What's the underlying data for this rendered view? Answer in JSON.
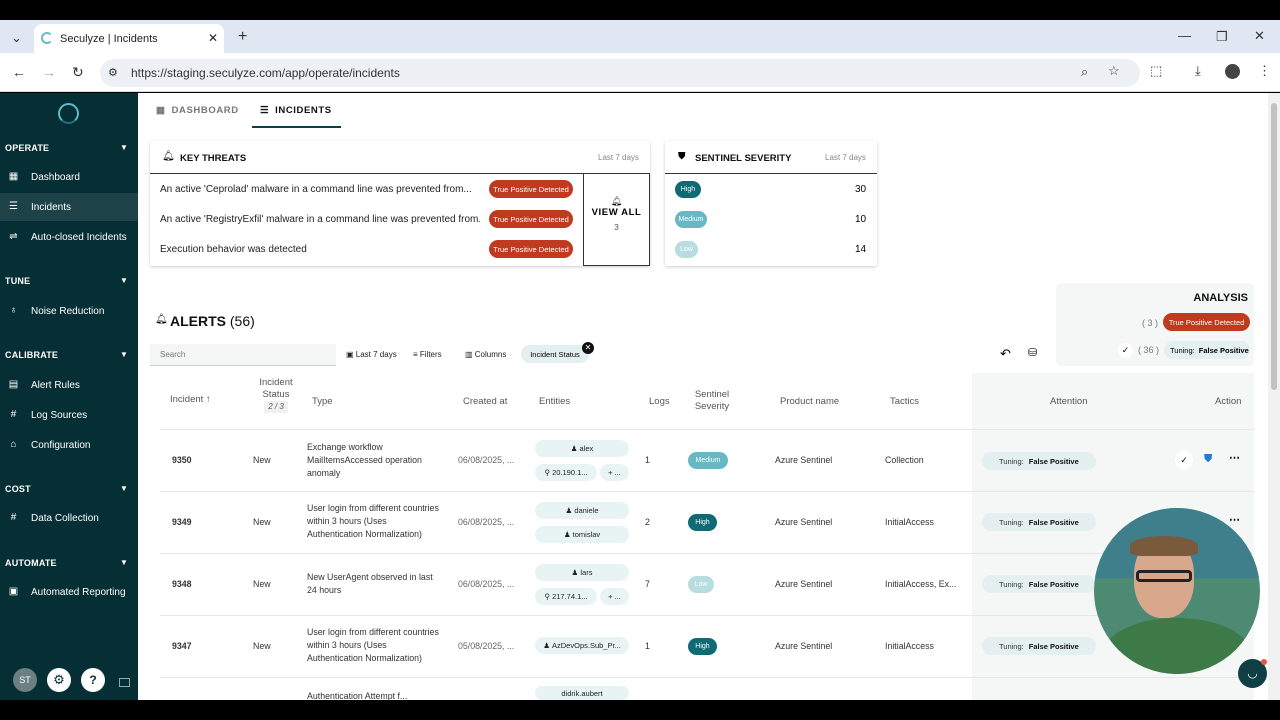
{
  "browser": {
    "tab_title": "Seculyze | Incidents",
    "url": "https://staging.seculyze.com/app/operate/incidents",
    "profile_initials": ""
  },
  "sidebar": {
    "sections": [
      "OPERATE",
      "TUNE",
      "CALIBRATE",
      "COST",
      "AUTOMATE"
    ],
    "items": {
      "dashboard": "Dashboard",
      "incidents": "Incidents",
      "autoclosed": "Auto-closed Incidents",
      "noise": "Noise Reduction",
      "alert_rules": "Alert Rules",
      "log_sources": "Log Sources",
      "configuration": "Configuration",
      "data_collection": "Data Collection",
      "reporting": "Automated Reporting"
    },
    "avatar": "ST",
    "help": "?"
  },
  "nav": {
    "dashboard": "DASHBOARD",
    "incidents": "INCIDENTS"
  },
  "key_threats": {
    "title": "KEY THREATS",
    "period": "Last 7 days",
    "rows": [
      "An active 'Ceprolad' malware in a command line was prevented from...",
      "An active 'RegistryExfil' malware in a command line was prevented from...",
      "Execution behavior was detected"
    ],
    "badge": "True Positive Detected",
    "view_all": "VIEW ALL",
    "view_count": "3"
  },
  "severity": {
    "title": "SENTINEL SEVERITY",
    "period": "Last 7 days",
    "rows": [
      {
        "label": "High",
        "count": "30"
      },
      {
        "label": "Medium",
        "count": "10"
      },
      {
        "label": "Low",
        "count": "14"
      }
    ]
  },
  "analysis": {
    "title": "ANALYSIS",
    "tp_count": "( 3 )",
    "tp_label": "True Positive Detected",
    "tuning_count": "( 36 )",
    "tuning_label": "Tuning:",
    "tuning_value": "False Positive"
  },
  "alerts": {
    "title": "ALERTS",
    "count": "(56)",
    "search_placeholder": "Search",
    "filter_period": "Last 7 days",
    "filters": "Filters",
    "columns": "Columns",
    "status_chip": "Incident Status"
  },
  "table": {
    "headers": {
      "incident": "Incident",
      "status": "Incident Status",
      "status_count": "2 / 3",
      "type": "Type",
      "created": "Created at",
      "entities": "Entities",
      "logs": "Logs",
      "severity": "Sentinel Severity",
      "product": "Product name",
      "tactics": "Tactics",
      "attention": "Attention",
      "action": "Action"
    },
    "rows": [
      {
        "id": "9350",
        "status": "New",
        "type": "Exchange workflow MailItemsAccessed operation anomaly",
        "created": "06/08/2025, ...",
        "e1": "alex",
        "e2": "20.190.1...",
        "more": "+ ...",
        "logs": "1",
        "sev": "Medium",
        "product": "Azure Sentinel",
        "tactics": "Collection",
        "tuning": "Tuning:",
        "tuning_v": "False Positive"
      },
      {
        "id": "9349",
        "status": "New",
        "type": "User login from different countries within 3 hours (Uses Authentication Normalization)",
        "created": "06/08/2025, ...",
        "e1": "daniele",
        "e2": "tomislav",
        "more": "",
        "logs": "2",
        "sev": "High",
        "product": "Azure Sentinel",
        "tactics": "InitialAccess",
        "tuning": "Tuning:",
        "tuning_v": "False Positive"
      },
      {
        "id": "9348",
        "status": "New",
        "type": "New UserAgent observed in last 24 hours",
        "created": "06/08/2025, ...",
        "e1": "lars",
        "e2": "217.74.1...",
        "more": "+ ...",
        "logs": "7",
        "sev": "Low",
        "product": "Azure Sentinel",
        "tactics": "InitialAccess, Ex...",
        "tuning": "Tuning:",
        "tuning_v": "False Positive"
      },
      {
        "id": "9347",
        "status": "New",
        "type": "User login from different countries within 3 hours (Uses Authentication Normalization)",
        "created": "05/08/2025, ...",
        "e1": "AzDevOps.Sub_Pr...",
        "e2": "",
        "more": "",
        "logs": "1",
        "sev": "High",
        "product": "Azure Sentinel",
        "tactics": "InitialAccess",
        "tuning": "Tuning:",
        "tuning_v": "False Positive"
      },
      {
        "id": "",
        "status": "",
        "type": "Authentication Attempt f...",
        "created": "",
        "e1": "didrik.aubert",
        "e2": "",
        "more": "",
        "logs": "",
        "sev": "",
        "product": "",
        "tactics": "",
        "tuning": "",
        "tuning_v": ""
      }
    ]
  },
  "colors": {
    "sidebar": "#062f35",
    "accent": "#0f6a73",
    "tp_badge": "#bf3a1f"
  }
}
